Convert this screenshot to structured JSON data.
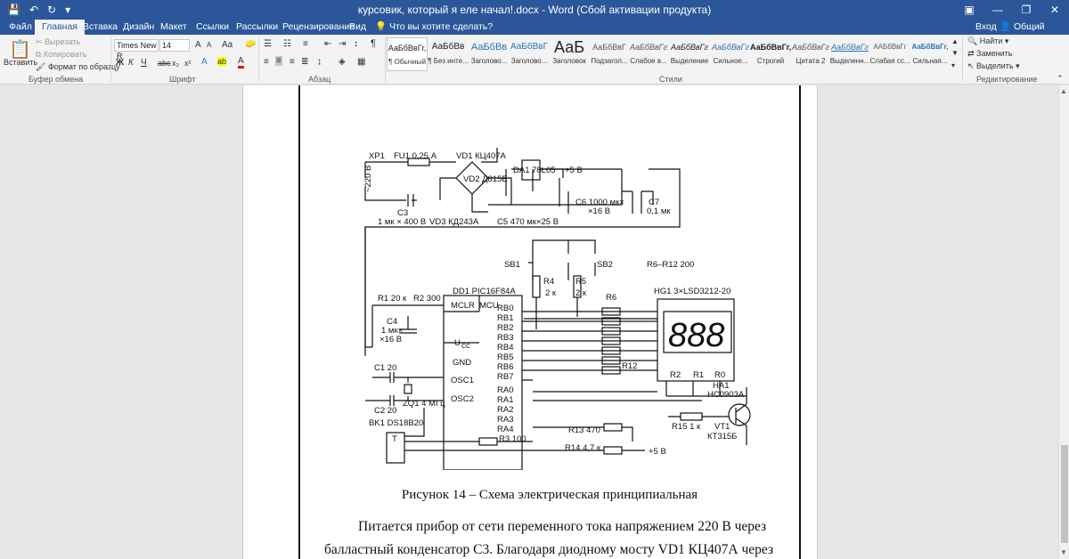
{
  "titlebar": {
    "title": "курсовик, который я еле начал!.docx - Word (Сбой активации продукта)",
    "qat": {
      "save": "💾",
      "undo": "↶",
      "redo": "↻",
      "more": "▾"
    },
    "controls": {
      "options": "▣",
      "minimize": "—",
      "maximize": "❐",
      "close": "✕"
    }
  },
  "tabs": [
    "Файл",
    "Главная",
    "Вставка",
    "Дизайн",
    "Макет",
    "Ссылки",
    "Рассылки",
    "Рецензирование",
    "Вид"
  ],
  "active_tab": "Главная",
  "tell_me": "Что вы хотите сделать?",
  "account": {
    "signin": "Вход",
    "share": "Общий доступ"
  },
  "clipboard": {
    "paste": "Вставить",
    "cut": "Вырезать",
    "copy": "Копировать",
    "format_painter": "Формат по образцу",
    "label": "Буфер обмена"
  },
  "font": {
    "name": "Times New R",
    "size": "14",
    "grow": "A",
    "shrink": "A",
    "case": "Aa",
    "bold": "Ж",
    "italic": "К",
    "underline": "Ч",
    "strike": "abc",
    "subscript": "x₂",
    "superscript": "x²",
    "label": "Шрифт"
  },
  "paragraph": {
    "label": "Абзац",
    "pilcrow": "¶"
  },
  "styles": {
    "label": "Стили",
    "items": [
      {
        "preview": "АаБбВвГг,",
        "name": "¶ Обычный"
      },
      {
        "preview": "АаБбВв",
        "name": "¶ Без инте..."
      },
      {
        "preview": "АаБбВв",
        "name": "Заголово..."
      },
      {
        "preview": "АаБбВвГ",
        "name": "Заголово..."
      },
      {
        "preview": "АаБ",
        "name": "Заголовок"
      },
      {
        "preview": "АаБбВвГ",
        "name": "Подзагол..."
      },
      {
        "preview": "АаБбВвГг",
        "name": "Слабое в..."
      },
      {
        "preview": "АаБбВвГг",
        "name": "Выделение"
      },
      {
        "preview": "АаБбВвГг",
        "name": "Сильное..."
      },
      {
        "preview": "АаБбВвГг,",
        "name": "Строгий"
      },
      {
        "preview": "АаБбВвГг",
        "name": "Цитата 2"
      },
      {
        "preview": "АаБбВвГг",
        "name": "Выделенн..."
      },
      {
        "preview": "ААБбВвГг",
        "name": "Слабая сс..."
      },
      {
        "preview": "АаБбВвГг,",
        "name": "Сильная..."
      }
    ]
  },
  "editing": {
    "label": "Редактирование",
    "find": "Найти",
    "replace": "Заменить",
    "select": "Выделить"
  },
  "document": {
    "caption": "Рисунок 14 – Схема электрическая принципиальная",
    "para1": "Питается прибор от сети переменного тока напряжением 220 В через",
    "para2": "балластный конденсатор С3. Благодаря диодному мосту VD1 КЦ407А через"
  },
  "schematic": {
    "labels": [
      "XP1",
      "FU1 0,25 А",
      "VD1 КЦ407А",
      "VD2 Д815Е",
      "DA1 78L05",
      "+5 В",
      "~220 В",
      "C3",
      "1 мк × 400 В",
      "VD3 КД243А",
      "C5 470 мк×25 В",
      "C6 1000 мк×",
      "×16 В",
      "C7",
      "0,1 мк",
      "SB1",
      "SB2",
      "R6–R12 200",
      "R4",
      "2 к",
      "R5",
      "2 к",
      "R6",
      "HG1 3×LSD3212-20",
      "R1 20 к",
      "R2 300",
      "DD1 PIC16F84A",
      "MCLR",
      "MCU",
      "C4",
      "1 мк×",
      "×16 В",
      "U",
      "CC",
      "GND",
      "OSC1",
      "OSC2",
      "RB0",
      "RB1",
      "RB2",
      "RB3",
      "RB4",
      "RB5",
      "RB6",
      "RB7",
      "RA0",
      "RA1",
      "RA2",
      "RA3",
      "RA4",
      "C1 20",
      "C2 20",
      "ZQ1 4 МГц",
      "R12",
      "R2",
      "R1",
      "R0",
      "HA1",
      "HC0903A",
      "R15 1 к",
      "VT1",
      "КТ315Б",
      "BK1 DS18B20",
      "T",
      "R3 100",
      "R13 470",
      "R14 4,7 к",
      "+5 В",
      "888"
    ]
  }
}
